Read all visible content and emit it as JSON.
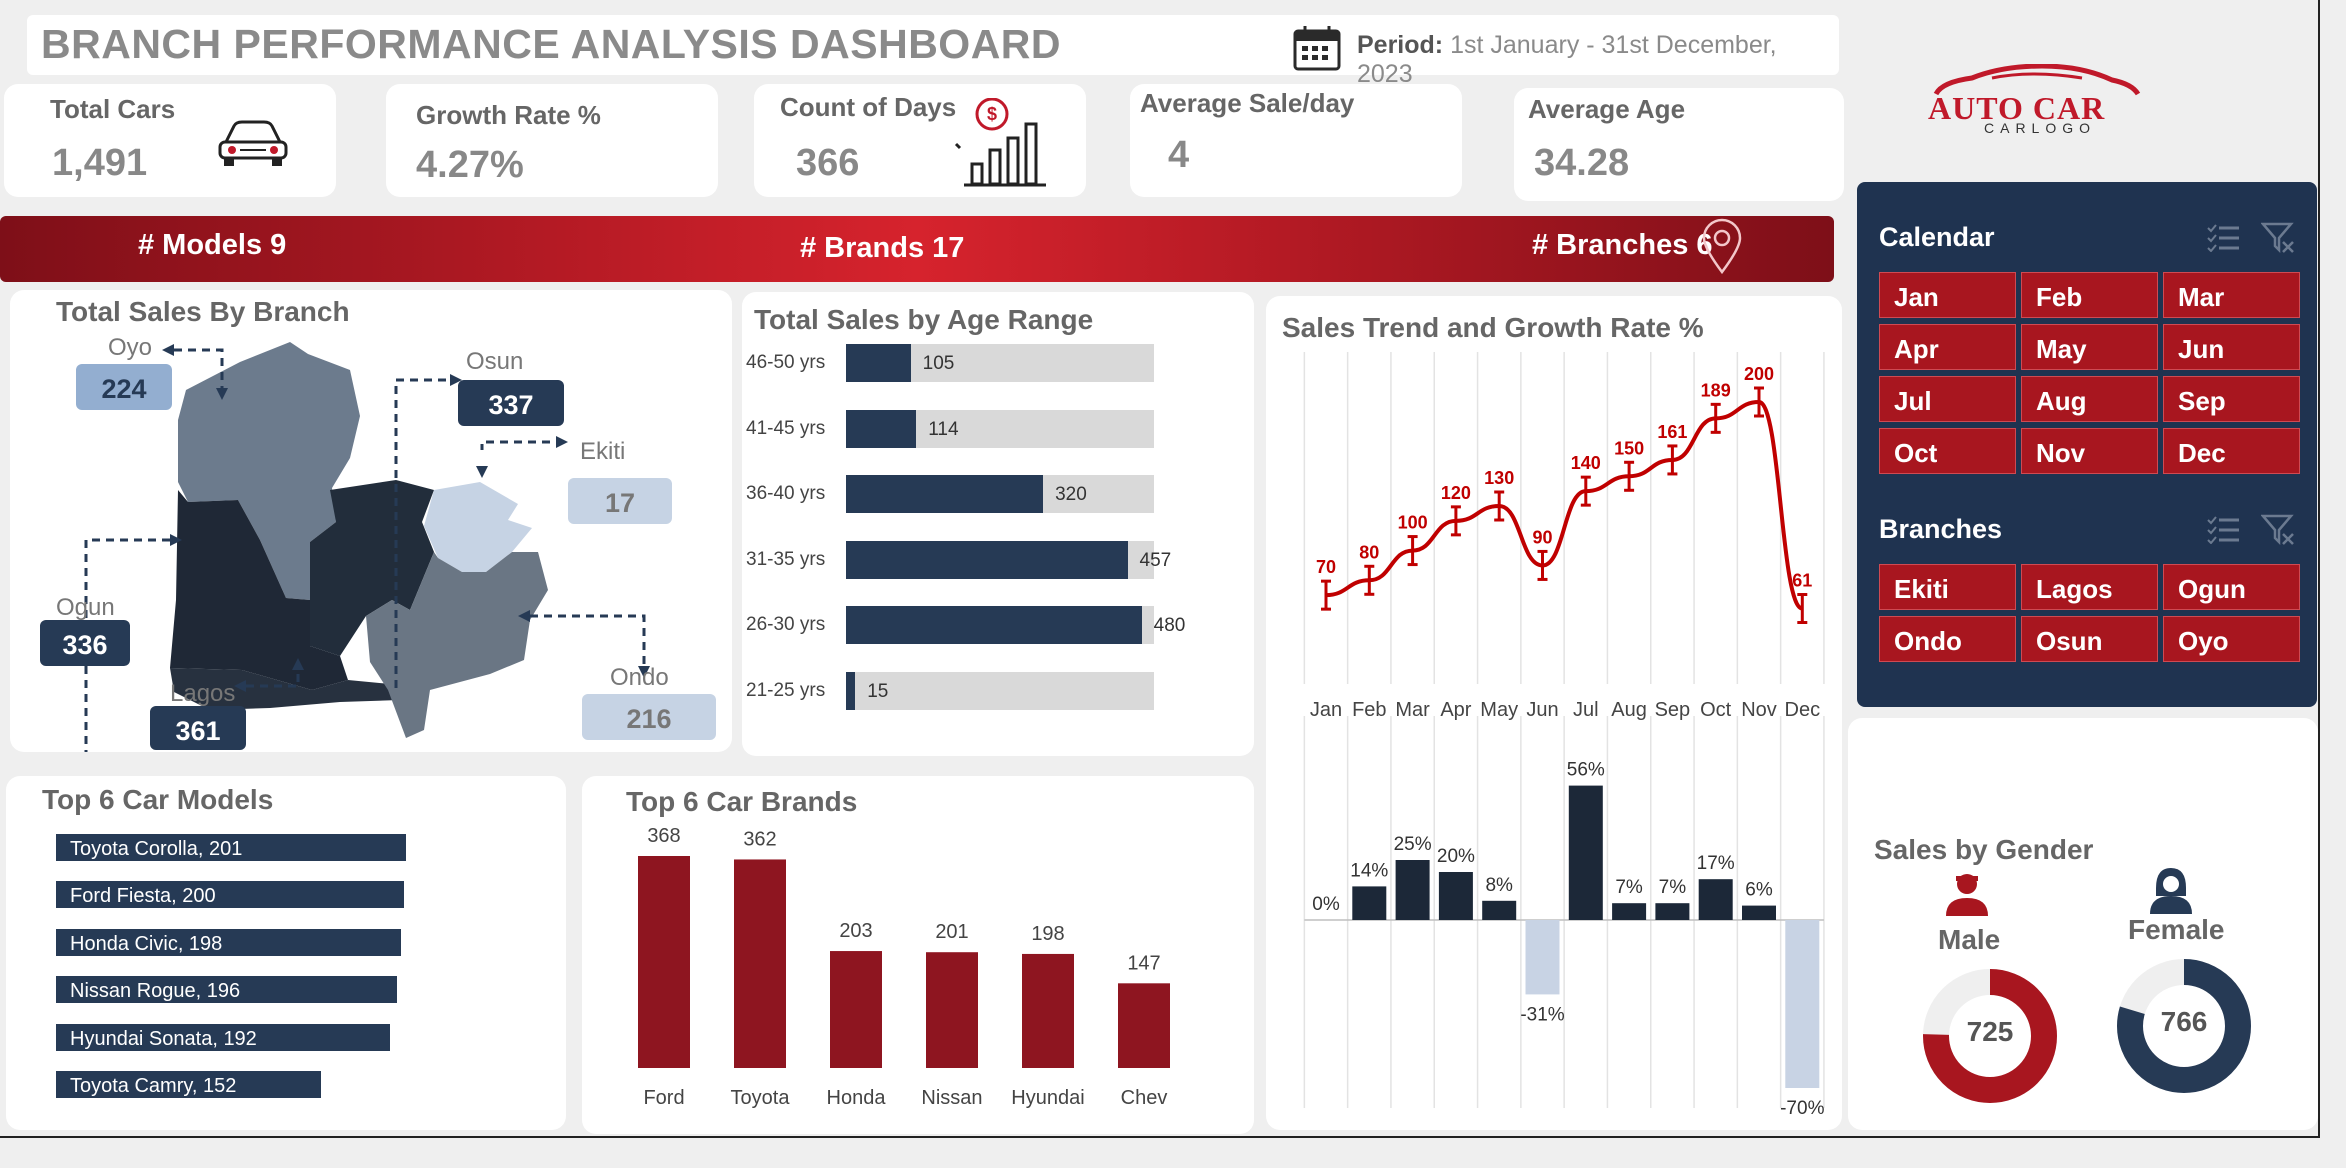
{
  "title": "BRANCH PERFORMANCE ANALYSIS DASHBOARD",
  "period": {
    "label": "Period:",
    "value": "1st January - 31st December, 2023"
  },
  "kpis": [
    {
      "label": "Total Cars",
      "value": "1,491"
    },
    {
      "label": "Growth Rate %",
      "value": "4.27%"
    },
    {
      "label": "Count of Days",
      "value": "366"
    },
    {
      "label": "Average Sale/day",
      "value": "4"
    },
    {
      "label": "Average Age",
      "value": "34.28"
    }
  ],
  "logo": {
    "line1": "AUTO CAR",
    "line2": "CARLOGO"
  },
  "banner": {
    "models": "# Models 9",
    "brands": "# Brands 17",
    "branches": "# Branches 6"
  },
  "branch_map": {
    "title": "Total Sales By Branch",
    "branches": [
      {
        "name": "Oyo",
        "value": "224"
      },
      {
        "name": "Osun",
        "value": "337"
      },
      {
        "name": "Ekiti",
        "value": "17"
      },
      {
        "name": "Ogun",
        "value": "336"
      },
      {
        "name": "Lagos",
        "value": "361"
      },
      {
        "name": "Ondo",
        "value": "216"
      }
    ]
  },
  "age_chart": {
    "title": "Total Sales by Age Range",
    "max": 500,
    "rows": [
      {
        "label": "46-50 yrs",
        "value": 105
      },
      {
        "label": "41-45 yrs",
        "value": 114
      },
      {
        "label": "36-40 yrs",
        "value": 320
      },
      {
        "label": "31-35 yrs",
        "value": 457
      },
      {
        "label": "26-30 yrs",
        "value": 480
      },
      {
        "label": "21-25 yrs",
        "value": 15
      }
    ]
  },
  "trend": {
    "title": "Sales Trend and Growth Rate %",
    "months": [
      "Jan",
      "Feb",
      "Mar",
      "Apr",
      "May",
      "Jun",
      "Jul",
      "Aug",
      "Sep",
      "Oct",
      "Nov",
      "Dec"
    ],
    "sales": [
      70,
      80,
      100,
      120,
      130,
      90,
      140,
      150,
      161,
      189,
      200,
      61
    ],
    "growth": [
      0,
      14,
      25,
      20,
      8,
      -31,
      56,
      7,
      7,
      17,
      6,
      -70
    ],
    "growth_labels": [
      "0%",
      "14%",
      "25%",
      "20%",
      "8%",
      "-31%",
      "56%",
      "7%",
      "7%",
      "17%",
      "6%",
      "-70%"
    ],
    "line_color": "#c00000",
    "pos_color": "#1c2838",
    "neg_color": "#c8d3e4"
  },
  "slicers": {
    "calendar_title": "Calendar",
    "months": [
      "Jan",
      "Feb",
      "Mar",
      "Apr",
      "May",
      "Jun",
      "Jul",
      "Aug",
      "Sep",
      "Oct",
      "Nov",
      "Dec"
    ],
    "branches_title": "Branches",
    "branches": [
      "Ekiti",
      "Lagos",
      "Ogun",
      "Ondo",
      "Osun",
      "Oyo"
    ]
  },
  "models": {
    "title": "Top 6 Car Models",
    "rows": [
      {
        "label": "Toyota Corolla, 201",
        "value": 201
      },
      {
        "label": "Ford Fiesta, 200",
        "value": 200
      },
      {
        "label": "Honda Civic, 198",
        "value": 198
      },
      {
        "label": "Nissan Rogue, 196",
        "value": 196
      },
      {
        "label": "Hyundai Sonata, 192",
        "value": 192
      },
      {
        "label": "Toyota Camry, 152",
        "value": 152
      }
    ]
  },
  "brands": {
    "title": "Top 6 Car Brands",
    "categories": [
      "Ford",
      "Toyota",
      "Honda",
      "Nissan",
      "Hyundai",
      "Chev"
    ],
    "values": [
      368,
      362,
      203,
      201,
      198,
      147
    ]
  },
  "gender": {
    "title": "Sales by Gender",
    "male_label": "Male",
    "male_value": "725",
    "female_label": "Female",
    "female_value": "766",
    "male_color": "#a8161f",
    "female_color": "#263a55"
  },
  "chart_data": [
    {
      "type": "bar",
      "title": "Total Sales by Age Range",
      "categories": [
        "46-50 yrs",
        "41-45 yrs",
        "36-40 yrs",
        "31-35 yrs",
        "26-30 yrs",
        "21-25 yrs"
      ],
      "values": [
        105,
        114,
        320,
        457,
        480,
        15
      ]
    },
    {
      "type": "line",
      "title": "Sales Trend and Growth Rate %",
      "categories": [
        "Jan",
        "Feb",
        "Mar",
        "Apr",
        "May",
        "Jun",
        "Jul",
        "Aug",
        "Sep",
        "Oct",
        "Nov",
        "Dec"
      ],
      "values": [
        70,
        80,
        100,
        120,
        130,
        90,
        140,
        150,
        161,
        189,
        200,
        61
      ]
    },
    {
      "type": "bar",
      "categories": [
        "Jan",
        "Feb",
        "Mar",
        "Apr",
        "May",
        "Jun",
        "Jul",
        "Aug",
        "Sep",
        "Oct",
        "Nov",
        "Dec"
      ],
      "values": [
        0,
        14,
        25,
        20,
        8,
        -31,
        56,
        7,
        7,
        17,
        6,
        -70
      ]
    },
    {
      "type": "bar",
      "title": "Top 6 Car Models",
      "categories": [
        "Toyota Corolla",
        "Ford Fiesta",
        "Honda Civic",
        "Nissan Rogue",
        "Hyundai Sonata",
        "Toyota Camry"
      ],
      "values": [
        201,
        200,
        198,
        196,
        192,
        152
      ]
    },
    {
      "type": "bar",
      "title": "Top 6 Car Brands",
      "categories": [
        "Ford",
        "Toyota",
        "Honda",
        "Nissan",
        "Hyundai",
        "Chev"
      ],
      "values": [
        368,
        362,
        203,
        201,
        198,
        147
      ]
    },
    {
      "type": "pie",
      "title": "Sales by Gender",
      "categories": [
        "Male",
        "Female"
      ],
      "values": [
        725,
        766
      ]
    }
  ]
}
